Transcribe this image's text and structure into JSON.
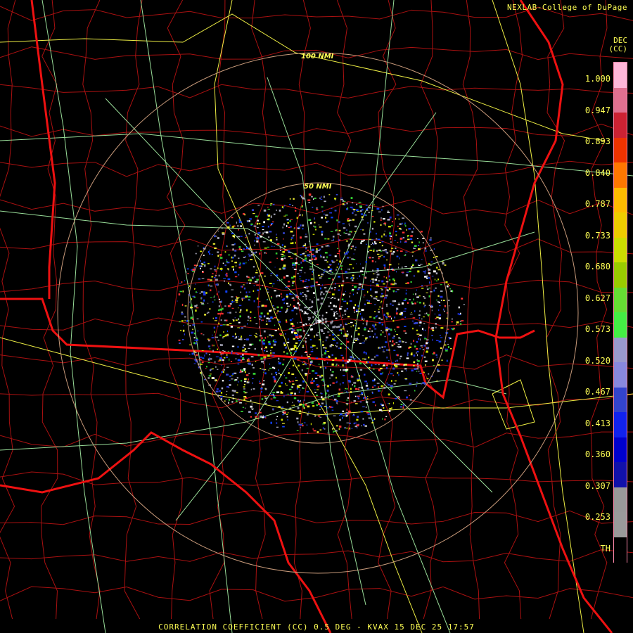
{
  "credit": "NEXLAB-College of DuPage",
  "units": {
    "line1": "DEC",
    "line2": "(CC)"
  },
  "ring_labels": [
    "100 NMI",
    "50 NMI"
  ],
  "scale": {
    "ticks": [
      "1.000",
      "0.947",
      "0.893",
      "0.840",
      "0.787",
      "0.733",
      "0.680",
      "0.627",
      "0.573",
      "0.520",
      "0.467",
      "0.413",
      "0.360",
      "0.307",
      "0.253",
      "TH"
    ],
    "colors": [
      "#ffb6d9",
      "#e07090",
      "#cc2233",
      "#ee3300",
      "#ff7700",
      "#ffbb00",
      "#eecc00",
      "#ccdd00",
      "#99cc00",
      "#66dd33",
      "#44ee44",
      "#9999cc",
      "#8888dd",
      "#3344cc",
      "#1122ee",
      "#0000cc",
      "#1111aa",
      "#999999",
      "#9a9a9a",
      "#000000"
    ]
  },
  "footer": "CORRELATION COEFFICIENT (CC) 0.5 DEG - KVAX 15 DEC 25 17:57"
}
